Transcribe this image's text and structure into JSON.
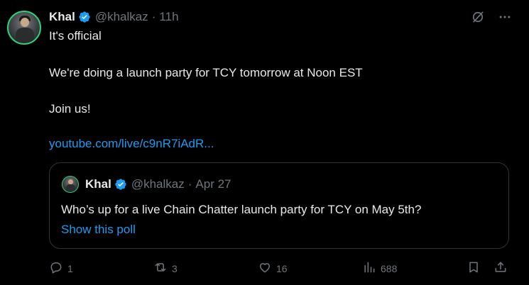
{
  "post": {
    "author_name": "Khal",
    "author_handle": "@khalkaz",
    "separator": "·",
    "time": "11h",
    "lines": [
      "It's official",
      "We're doing a launch party for TCY tomorrow at Noon EST",
      "Join us!"
    ],
    "link": "youtube.com/live/c9nR7iAdR..."
  },
  "quote": {
    "author_name": "Khal",
    "author_handle": "@khalkaz",
    "separator": "·",
    "date": "Apr 27",
    "text": "Who’s up for a live Chain Chatter launch party for TCY on May 5th?",
    "poll_link": "Show this poll"
  },
  "actions": {
    "replies": "1",
    "reposts": "3",
    "likes": "16",
    "views": "688"
  },
  "icons": {
    "verified": "verified-badge-icon",
    "grok": "grok-icon",
    "more": "more-icon",
    "reply": "reply-icon",
    "repost": "repost-icon",
    "like": "heart-icon",
    "views": "views-icon",
    "bookmark": "bookmark-icon",
    "share": "share-icon"
  },
  "colors": {
    "background": "#000000",
    "text": "#e7e9ea",
    "muted": "#71767b",
    "link": "#1d9bf0",
    "verified": "#1d9bf0",
    "avatar_ring": "#2fd07a"
  }
}
